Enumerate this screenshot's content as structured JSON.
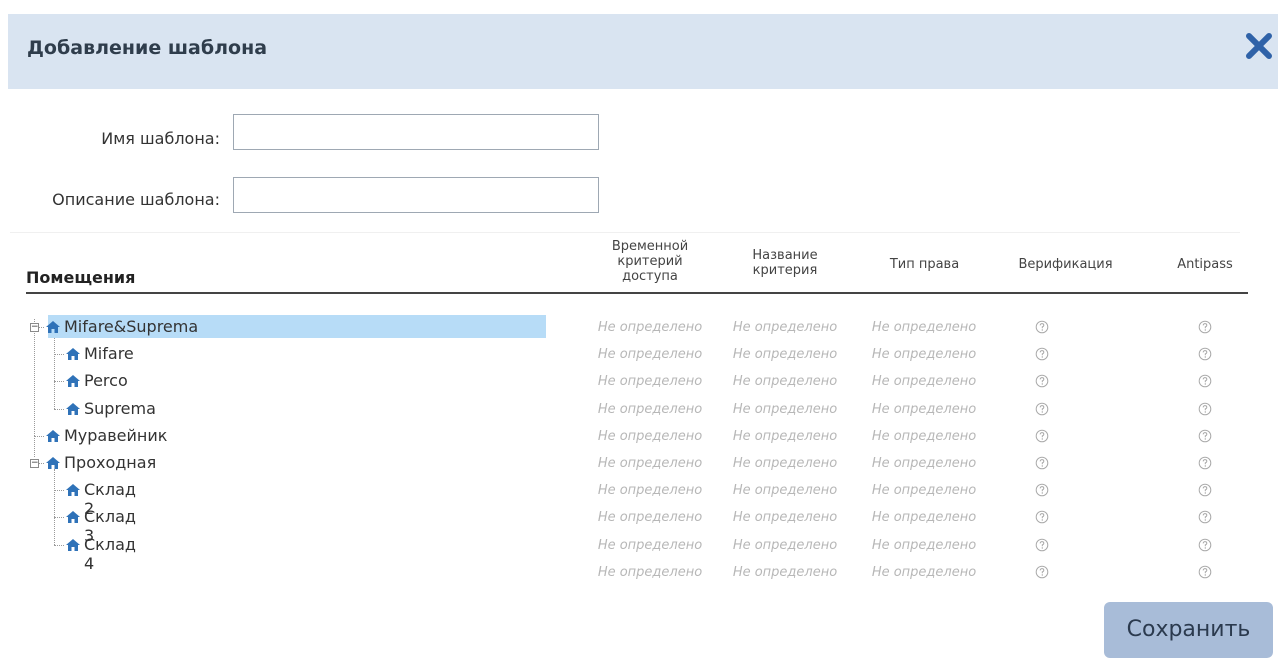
{
  "dialog": {
    "title": "Добавление шаблона",
    "close_icon": "close-icon"
  },
  "form": {
    "name_label": "Имя шаблона:",
    "name_value": "",
    "description_label": "Описание шаблона:",
    "description_value": ""
  },
  "table": {
    "rooms_header": "Помещения",
    "columns": [
      {
        "label": "Временной критерий доступа"
      },
      {
        "label": "Название критерия"
      },
      {
        "label": "Тип права"
      },
      {
        "label": "Верификация"
      },
      {
        "label": "Antipass"
      }
    ],
    "column_lines": {
      "c0": [
        "Временной",
        "критерий",
        "доступа"
      ],
      "c1": [
        "Название",
        "критерия"
      ],
      "c2": [
        "Тип права"
      ],
      "c3": [
        "Верификация"
      ],
      "c4": [
        "Antipass"
      ]
    },
    "undefined_text": "Не определено",
    "rows": [
      {
        "name": "Mifare&Suprema",
        "level": 0,
        "expanded": true,
        "selected": true
      },
      {
        "name": "Mifare",
        "level": 1
      },
      {
        "name": "Perco",
        "level": 1
      },
      {
        "name": "Suprema",
        "level": 1
      },
      {
        "name": "Муравейник",
        "level": 0
      },
      {
        "name": "Проходная",
        "level": 0,
        "expanded": true
      },
      {
        "name": "Склад 2",
        "level": 1
      },
      {
        "name": "Склад 3",
        "level": 1
      },
      {
        "name": "Склад 4",
        "level": 1
      },
      {
        "name": "",
        "level": -1
      }
    ]
  },
  "actions": {
    "save_label": "Сохранить"
  },
  "colors": {
    "header_bg": "#d9e4f1",
    "selection": "#b7dcf7",
    "house_icon": "#2f72b8",
    "save_button": "#a8bcd8"
  }
}
